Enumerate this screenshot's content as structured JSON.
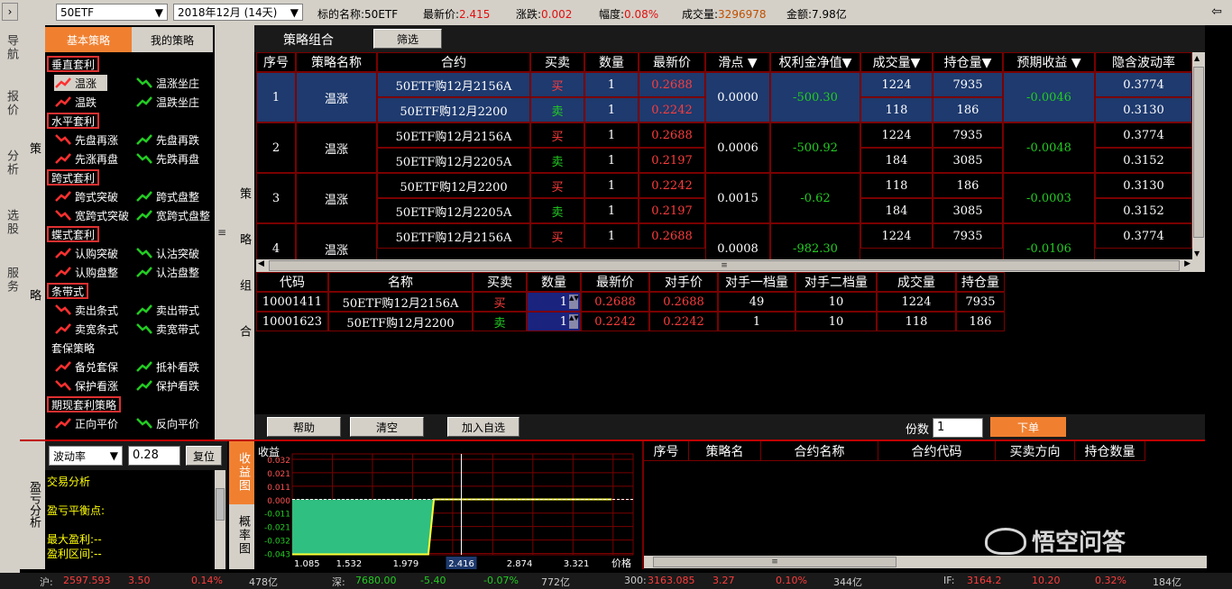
{
  "topbar": {
    "symbol": "50ETF",
    "month": "2018年12月 (14天)",
    "label_name": "标的名称:",
    "name_val": "50ETF",
    "label_price": "最新价:",
    "price_val": "2.415",
    "label_chg": "涨跌:",
    "chg_val": "0.002",
    "label_pct": "幅度:",
    "pct_val": "0.08%",
    "label_vol": "成交量:",
    "vol_val": "3296978",
    "label_amt": "金额:",
    "amt_val": "7.98亿"
  },
  "left_nav": {
    "items": [
      "导航",
      "报价",
      "分析",
      "选股",
      "服务"
    ]
  },
  "strategy_side_label": "策略",
  "strategy_tabs": {
    "basic": "基本策略",
    "mine": "我的策略"
  },
  "strategy_groups": [
    {
      "cat": "垂直套利",
      "boxed": true,
      "items": [
        "温涨",
        "温涨坐庄",
        "温跌",
        "温跌坐庄"
      ]
    },
    {
      "cat": "水平套利",
      "boxed": true,
      "items": [
        "先盘再涨",
        "先盘再跌",
        "先涨再盘",
        "先跌再盘"
      ]
    },
    {
      "cat": "跨式套利",
      "boxed": true,
      "items": [
        "跨式突破",
        "跨式盘整",
        "宽跨式突破",
        "宽跨式盘整"
      ]
    },
    {
      "cat": "蝶式套利",
      "boxed": true,
      "items": [
        "认购突破",
        "认沽突破",
        "认购盘整",
        "认沽盘整"
      ]
    },
    {
      "cat": "条带式",
      "boxed": true,
      "items": [
        "卖出条式",
        "卖出带式",
        "卖宽条式",
        "卖宽带式"
      ]
    },
    {
      "cat": "套保策略",
      "boxed": false,
      "items": [
        "备兑套保",
        "抵补看跌",
        "保护看涨",
        "保护看跌"
      ]
    },
    {
      "cat": "期现套利策略",
      "boxed": true,
      "items": [
        "正向平价",
        "反向平价"
      ]
    }
  ],
  "combo_tab": "策略组合",
  "filter_btn": "筛选",
  "combo_side_label": "策略组合",
  "combo_table": {
    "headers": [
      "序号",
      "策略名称",
      "合约",
      "买卖",
      "数量",
      "最新价",
      "滑点 ▼",
      "权利金净值▼",
      "成交量▼",
      "持仓量▼",
      "预期收益 ▼",
      "隐含波动率"
    ],
    "groups": [
      {
        "seq": "1",
        "name": "温涨",
        "slip": "0.0000",
        "net": "-500.30",
        "exp": "-0.0046",
        "selected": true,
        "legs": [
          {
            "contract": "50ETF购12月2156A",
            "side": "买",
            "qty": "1",
            "price": "0.2688",
            "vol": "1224",
            "oi": "7935",
            "iv": "0.3774"
          },
          {
            "contract": "50ETF购12月2200",
            "side": "卖",
            "qty": "1",
            "price": "0.2242",
            "vol": "118",
            "oi": "186",
            "iv": "0.3130"
          }
        ]
      },
      {
        "seq": "2",
        "name": "温涨",
        "slip": "0.0006",
        "net": "-500.92",
        "exp": "-0.0048",
        "selected": false,
        "legs": [
          {
            "contract": "50ETF购12月2156A",
            "side": "买",
            "qty": "1",
            "price": "0.2688",
            "vol": "1224",
            "oi": "7935",
            "iv": "0.3774"
          },
          {
            "contract": "50ETF购12月2205A",
            "side": "卖",
            "qty": "1",
            "price": "0.2197",
            "vol": "184",
            "oi": "3085",
            "iv": "0.3152"
          }
        ]
      },
      {
        "seq": "3",
        "name": "温涨",
        "slip": "0.0015",
        "net": "-0.62",
        "exp": "-0.0003",
        "selected": false,
        "legs": [
          {
            "contract": "50ETF购12月2200",
            "side": "买",
            "qty": "1",
            "price": "0.2242",
            "vol": "118",
            "oi": "186",
            "iv": "0.3130"
          },
          {
            "contract": "50ETF购12月2205A",
            "side": "卖",
            "qty": "1",
            "price": "0.2197",
            "vol": "184",
            "oi": "3085",
            "iv": "0.3152"
          }
        ]
      },
      {
        "seq": "4",
        "name": "温涨",
        "slip": "0.0008",
        "net": "-982.30",
        "exp": "-0.0106",
        "selected": false,
        "legs": [
          {
            "contract": "50ETF购12月2156A",
            "side": "买",
            "qty": "1",
            "price": "0.2688",
            "vol": "1224",
            "oi": "7935",
            "iv": "0.3774"
          }
        ]
      }
    ]
  },
  "order_table": {
    "headers": [
      "代码",
      "名称",
      "买卖",
      "数量",
      "最新价",
      "对手价",
      "对手一档量",
      "对手二档量",
      "成交量",
      "持仓量"
    ],
    "rows": [
      {
        "code": "10001411",
        "name": "50ETF购12月2156A",
        "side": "买",
        "qty": "1",
        "price": "0.2688",
        "opp": "0.2688",
        "l1": "49",
        "l2": "10",
        "vol": "1224",
        "oi": "7935"
      },
      {
        "code": "10001623",
        "name": "50ETF购12月2200",
        "side": "卖",
        "qty": "1",
        "price": "0.2242",
        "opp": "0.2242",
        "l1": "1",
        "l2": "10",
        "vol": "118",
        "oi": "186"
      }
    ]
  },
  "actions": {
    "help": "帮助",
    "clear": "清空",
    "add_fav": "加入自选",
    "copies_label": "份数",
    "copies_value": "1",
    "submit": "下单"
  },
  "pnl": {
    "side_label": "盈亏分析",
    "dropdown": "波动率",
    "value": "0.28",
    "reset": "复位",
    "title": "交易分析",
    "breakeven": "盈亏平衡点:",
    "max_profit": "最大盈利:--",
    "profit_range": "盈利区间:--"
  },
  "chart_tabs": {
    "payoff": "收益图",
    "prob": "概率图"
  },
  "chart_data": {
    "type": "area",
    "ylabel": "收益",
    "xlabel": "价格",
    "y_ticks": [
      "0.032",
      "0.021",
      "0.011",
      "0.000",
      "-0.011",
      "-0.021",
      "-0.032",
      "-0.043"
    ],
    "x_ticks": [
      "1.085",
      "1.532",
      "1.979",
      "2.416",
      "2.874",
      "3.321"
    ],
    "highlight_x": "2.416",
    "x": [
      1.085,
      2.156,
      2.2,
      3.6
    ],
    "y": [
      -0.0446,
      -0.0446,
      0.0,
      0.0
    ],
    "fill_color": "#2fbf80",
    "line_color": "#ffff33",
    "ylim": [
      -0.045,
      0.037
    ]
  },
  "positions": {
    "headers": [
      "序号",
      "策略名",
      "合约名称",
      "合约代码",
      "买卖方向",
      "持仓数量"
    ]
  },
  "watermark": "悟空问答",
  "statusbar": [
    {
      "k": "沪:",
      "v": "2597.593",
      "c": "3.50",
      "p": "0.14%",
      "a": "478亿"
    },
    {
      "k": "深:",
      "v": "7680.00",
      "c": "-5.40",
      "p": "-0.07%",
      "a": "772亿"
    },
    {
      "k": "300:",
      "v": "3163.085",
      "c": "3.27",
      "p": "0.10%",
      "a": "344亿"
    },
    {
      "k": "IF:",
      "v": "3164.2",
      "c": "10.20",
      "p": "0.32%",
      "a": "184亿"
    }
  ]
}
